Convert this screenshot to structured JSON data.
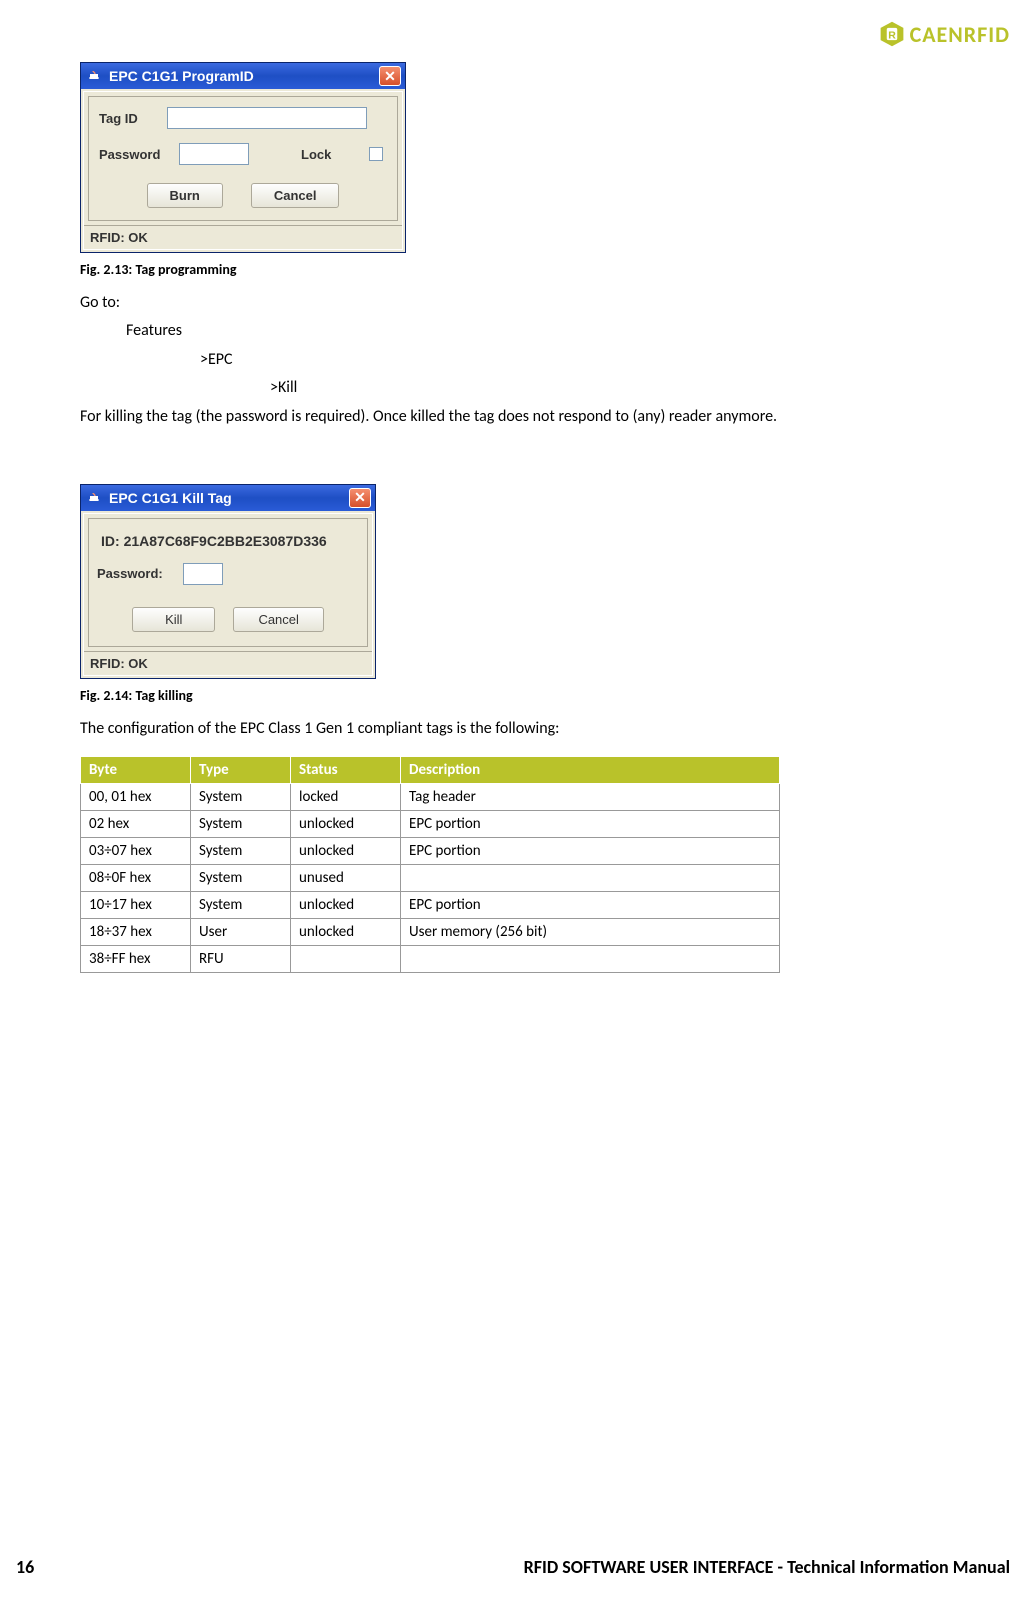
{
  "logo": {
    "text": "CAENRFID"
  },
  "dialog1": {
    "title": "EPC C1G1 ProgramID",
    "close_glyph": "✕",
    "tag_id_label": "Tag ID",
    "tag_id_value": "",
    "password_label": "Password",
    "password_value": "",
    "lock_label": "Lock",
    "burn_btn": "Burn",
    "cancel_btn": "Cancel",
    "status": "RFID: OK"
  },
  "caption1": "Fig. 2.13: Tag programming",
  "nav": {
    "goto": "Go to:",
    "features": "Features",
    "epc": ">EPC",
    "kill": ">Kill"
  },
  "kill_note": "For killing the tag (the password is required). Once killed the tag does not respond to (any) reader anymore.",
  "dialog2": {
    "title": "EPC C1G1 Kill Tag",
    "close_glyph": "✕",
    "id_prefix": "ID: ",
    "id_value": "21A87C68F9C2BB2E3087D336",
    "password_label": "Password:",
    "password_value": "",
    "kill_btn": "Kill",
    "cancel_btn": "Cancel",
    "status": "RFID: OK"
  },
  "caption2": "Fig. 2.14: Tag killing",
  "config_intro": "The configuration of the EPC Class 1 Gen 1 compliant tags is the following:",
  "table": {
    "headers": {
      "byte": "Byte",
      "type": "Type",
      "status": "Status",
      "desc": "Description"
    },
    "rows": [
      {
        "byte": "00, 01 hex",
        "type": "System",
        "status": "locked",
        "desc": "Tag header"
      },
      {
        "byte": "02 hex",
        "type": "System",
        "status": "unlocked",
        "desc": "EPC portion"
      },
      {
        "byte": "03÷07 hex",
        "type": "System",
        "status": "unlocked",
        "desc": "EPC portion"
      },
      {
        "byte": "08÷0F hex",
        "type": "System",
        "status": "unused",
        "desc": ""
      },
      {
        "byte": "10÷17 hex",
        "type": "System",
        "status": "unlocked",
        "desc": "EPC portion"
      },
      {
        "byte": "18÷37 hex",
        "type": "User",
        "status": "unlocked",
        "desc": "User memory (256 bit)"
      },
      {
        "byte": "38÷FF hex",
        "type": "RFU",
        "status": "",
        "desc": ""
      }
    ]
  },
  "footer": {
    "page": "16",
    "title": "RFID SOFTWARE USER INTERFACE - Technical Information Manual"
  }
}
